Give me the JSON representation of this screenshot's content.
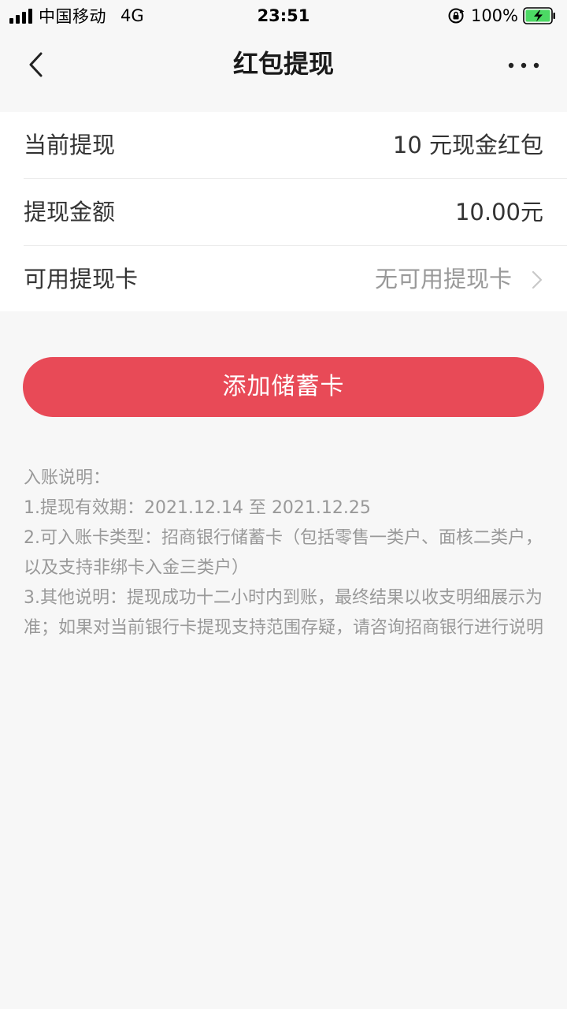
{
  "status_bar": {
    "carrier": "中国移动",
    "network": "4G",
    "time": "23:51",
    "battery_percent": "100%"
  },
  "nav": {
    "title": "红包提现",
    "back_icon": "chevron-left-icon",
    "more_icon": "more-dots-icon"
  },
  "rows": [
    {
      "label": "当前提现",
      "value": "10 元现金红包"
    },
    {
      "label": "提现金额",
      "value": "10.00元"
    },
    {
      "label": "可用提现卡",
      "value": "无可用提现卡"
    }
  ],
  "button": {
    "label": "添加储蓄卡"
  },
  "notes": {
    "title": "入账说明：",
    "line1": "1.提现有效期：2021.12.14 至 2021.12.25",
    "line2": "2.可入账卡类型：招商银行储蓄卡（包括零售一类户、面核二类户，以及支持非绑卡入金三类户）",
    "line3": "3.其他说明：提现成功十二小时内到账，最终结果以收支明细展示为准；如果对当前银行卡提现支持范围存疑，请咨询招商银行进行说明"
  },
  "colors": {
    "accent": "#e84a57",
    "background": "#f7f7f7",
    "card": "#ffffff",
    "muted_text": "#999999",
    "battery_green": "#4cd964"
  }
}
